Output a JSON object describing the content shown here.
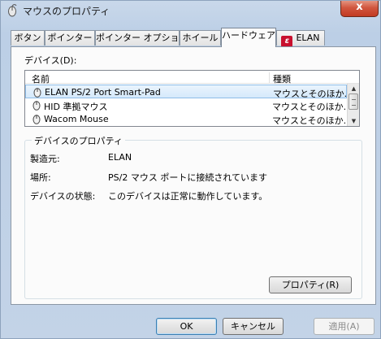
{
  "window": {
    "title": "マウスのプロパティ",
    "close_label": "x"
  },
  "tabs": [
    {
      "label": "ボタン"
    },
    {
      "label": "ポインター"
    },
    {
      "label": "ポインター オプション"
    },
    {
      "label": "ホイール"
    },
    {
      "label": "ハードウェア"
    },
    {
      "label": "ELAN"
    }
  ],
  "active_tab": "ハードウェア",
  "devices": {
    "label": "デバイス(D):",
    "columns": {
      "name": "名前",
      "type": "種類"
    },
    "rows": [
      {
        "name": "ELAN PS/2 Port Smart-Pad",
        "type": "マウスとそのほか..."
      },
      {
        "name": "HID 準拠マウス",
        "type": "マウスとそのほか..."
      },
      {
        "name": "Wacom Mouse",
        "type": "マウスとそのほか..."
      }
    ],
    "selected_row": 0
  },
  "properties": {
    "title": "デバイスのプロパティ",
    "manufacturer_label": "製造元:",
    "manufacturer_value": "ELAN",
    "location_label": "場所:",
    "location_value": "PS/2 マウス ポートに接続されています",
    "status_label": "デバイスの状態:",
    "status_value": "このデバイスは正常に動作しています。",
    "properties_button": "プロパティ(R)"
  },
  "footer": {
    "ok": "OK",
    "cancel": "キャンセル",
    "apply": "適用(A)"
  },
  "colors": {
    "accent": "#c8102e",
    "selection": "#d5e9fb"
  }
}
